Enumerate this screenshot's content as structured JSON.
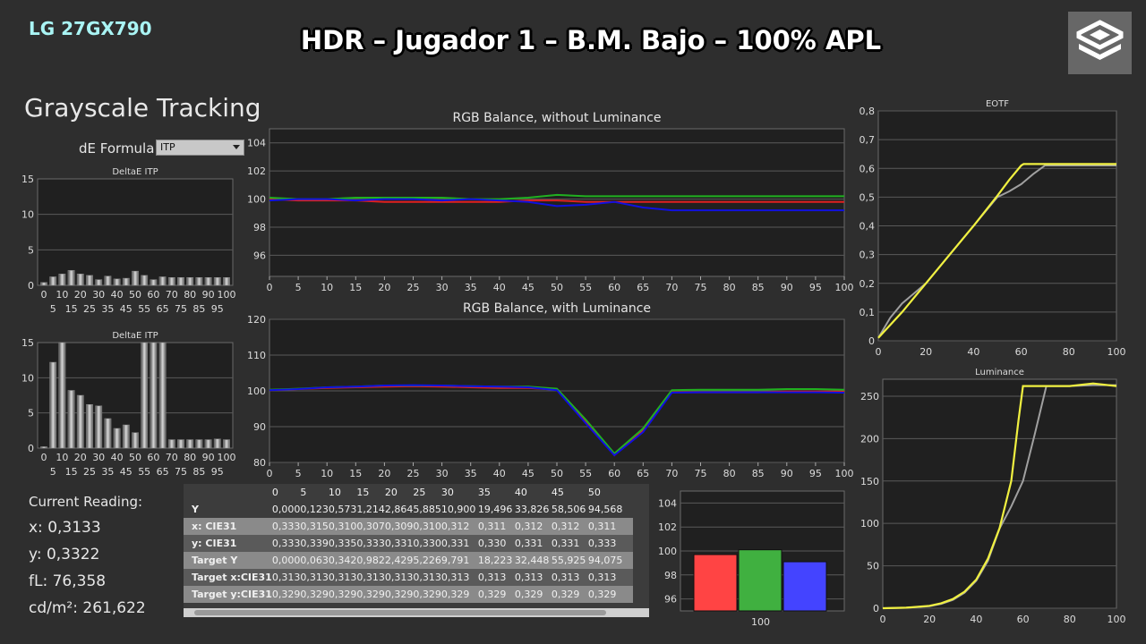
{
  "header": {
    "brand": "LG 27GX790",
    "title": "HDR – Jugador 1 – B.M. Bajo – 100% APL"
  },
  "section_title": "Grayscale Tracking",
  "de_formula": {
    "label": "dE Formula:",
    "value": "ITP"
  },
  "current_reading": {
    "label": "Current Reading:",
    "x": "x: 0,3133",
    "y": "y: 0,3322",
    "fl": "fL: 76,358",
    "cdm2": "cd/m²: 261,622"
  },
  "table": {
    "columns": [
      "0",
      "5",
      "10",
      "15",
      "20",
      "25",
      "30",
      "35",
      "40",
      "45",
      "50"
    ],
    "rows": [
      {
        "label": "Y",
        "values": [
          "0,000",
          "0,123",
          "0,573",
          "1,214",
          "2,864",
          "5,885",
          "10,900",
          "19,496",
          "33,826",
          "58,506",
          "94,568"
        ]
      },
      {
        "label": "x: CIE31",
        "values": [
          "0,333",
          "0,315",
          "0,310",
          "0,307",
          "0,309",
          "0,310",
          "0,312",
          "0,311",
          "0,312",
          "0,312",
          "0,311"
        ]
      },
      {
        "label": "y: CIE31",
        "values": [
          "0,333",
          "0,339",
          "0,335",
          "0,333",
          "0,331",
          "0,330",
          "0,331",
          "0,330",
          "0,331",
          "0,331",
          "0,333"
        ]
      },
      {
        "label": "Target Y",
        "values": [
          "0,000",
          "0,063",
          "0,342",
          "0,982",
          "2,429",
          "5,226",
          "9,791",
          "18,223",
          "32,448",
          "55,925",
          "94,075"
        ]
      },
      {
        "label": "Target x:CIE31",
        "values": [
          "0,313",
          "0,313",
          "0,313",
          "0,313",
          "0,313",
          "0,313",
          "0,313",
          "0,313",
          "0,313",
          "0,313",
          "0,313"
        ]
      },
      {
        "label": "Target y:CIE31",
        "values": [
          "0,329",
          "0,329",
          "0,329",
          "0,329",
          "0,329",
          "0,329",
          "0,329",
          "0,329",
          "0,329",
          "0,329",
          "0,329"
        ]
      }
    ]
  },
  "colors": {
    "red": "#e02020",
    "green": "#20b020",
    "blue": "#1010e0",
    "yellow": "#f0f040",
    "gray": "#a0a0a0",
    "plot_bg": "#202020",
    "grid": "#5a5a5a"
  },
  "chart_data": [
    {
      "id": "deltae_top",
      "type": "bar",
      "title": "DeltaE ITP",
      "ylim": [
        0,
        15
      ],
      "yticks": [
        0,
        5,
        10,
        15
      ],
      "categories": [
        "0",
        "5",
        "10",
        "15",
        "20",
        "25",
        "30",
        "35",
        "40",
        "45",
        "50",
        "55",
        "60",
        "65",
        "70",
        "75",
        "80",
        "85",
        "90",
        "95",
        "100"
      ],
      "xticks_top": [
        "0",
        "10",
        "20",
        "30",
        "40",
        "50",
        "60",
        "70",
        "80",
        "90",
        "100"
      ],
      "xticks_bottom": [
        "5",
        "15",
        "25",
        "35",
        "45",
        "55",
        "65",
        "75",
        "85",
        "95"
      ],
      "values": [
        0.4,
        1.2,
        1.6,
        2.1,
        1.6,
        1.4,
        0.8,
        1.3,
        0.9,
        1.0,
        2.0,
        1.4,
        0.8,
        1.2,
        1.1,
        1.1,
        1.1,
        1.1,
        1.1,
        1.1,
        1.1
      ]
    },
    {
      "id": "deltae_bottom",
      "type": "bar",
      "title": "DeltaE ITP",
      "ylim": [
        0,
        15
      ],
      "yticks": [
        0,
        5,
        10,
        15
      ],
      "categories": [
        "0",
        "5",
        "10",
        "15",
        "20",
        "25",
        "30",
        "35",
        "40",
        "45",
        "50",
        "55",
        "60",
        "65",
        "70",
        "75",
        "80",
        "85",
        "90",
        "95",
        "100"
      ],
      "xticks_top": [
        "0",
        "10",
        "20",
        "30",
        "40",
        "50",
        "60",
        "70",
        "80",
        "90",
        "100"
      ],
      "xticks_bottom": [
        "5",
        "15",
        "25",
        "35",
        "45",
        "55",
        "65",
        "75",
        "85",
        "95"
      ],
      "values": [
        0.2,
        12.2,
        15,
        8.2,
        7.5,
        6.2,
        6.0,
        4.2,
        2.8,
        3.3,
        2.2,
        15,
        15,
        15,
        1.2,
        1.2,
        1.2,
        1.2,
        1.2,
        1.3,
        1.2
      ]
    },
    {
      "id": "rgb_balance_no_lum",
      "type": "line",
      "title": "RGB Balance, without Luminance",
      "ylim": [
        94.5,
        105
      ],
      "yticks": [
        96,
        98,
        100,
        102,
        104
      ],
      "x": [
        0,
        5,
        10,
        15,
        20,
        25,
        30,
        35,
        40,
        45,
        50,
        55,
        60,
        65,
        70,
        75,
        80,
        85,
        90,
        95,
        100
      ],
      "xticks": [
        "0",
        "5",
        "10",
        "15",
        "20",
        "25",
        "30",
        "35",
        "40",
        "45",
        "50",
        "55",
        "60",
        "65",
        "70",
        "75",
        "80",
        "85",
        "90",
        "95",
        "100"
      ],
      "series": [
        {
          "color": "red",
          "values": [
            100.0,
            99.9,
            99.9,
            99.9,
            99.8,
            99.8,
            99.8,
            99.8,
            99.8,
            99.9,
            99.9,
            99.8,
            99.8,
            99.8,
            99.8,
            99.8,
            99.8,
            99.8,
            99.8,
            99.8,
            99.8
          ]
        },
        {
          "color": "green",
          "values": [
            100.1,
            100.0,
            100.0,
            100.1,
            100.1,
            100.1,
            100.1,
            100.0,
            100.0,
            100.1,
            100.3,
            100.2,
            100.2,
            100.2,
            100.2,
            100.2,
            100.2,
            100.2,
            100.2,
            100.2,
            100.2
          ]
        },
        {
          "color": "blue",
          "values": [
            99.9,
            100.0,
            100.0,
            99.9,
            100.0,
            100.0,
            99.9,
            100.0,
            99.9,
            99.8,
            99.5,
            99.6,
            99.8,
            99.4,
            99.2,
            99.2,
            99.2,
            99.2,
            99.2,
            99.2,
            99.2
          ]
        }
      ]
    },
    {
      "id": "rgb_balance_lum",
      "type": "line",
      "title": "RGB Balance, with Luminance",
      "ylim": [
        80,
        120
      ],
      "yticks": [
        80,
        90,
        100,
        110,
        120
      ],
      "x": [
        0,
        5,
        10,
        15,
        20,
        25,
        30,
        35,
        40,
        45,
        50,
        55,
        60,
        65,
        70,
        75,
        80,
        85,
        90,
        95,
        100
      ],
      "xticks": [
        "0",
        "5",
        "10",
        "15",
        "20",
        "25",
        "30",
        "35",
        "40",
        "45",
        "50",
        "55",
        "60",
        "65",
        "70",
        "75",
        "80",
        "85",
        "90",
        "95",
        "100"
      ],
      "series": [
        {
          "color": "red",
          "values": [
            100.2,
            100.5,
            100.8,
            101.0,
            101.2,
            101.3,
            101.2,
            101.0,
            100.8,
            100.8,
            100.3,
            91.5,
            82.0,
            89.0,
            99.6,
            99.6,
            99.6,
            99.6,
            99.8,
            99.8,
            99.8
          ]
        },
        {
          "color": "green",
          "values": [
            100.3,
            100.6,
            101.0,
            101.2,
            101.5,
            101.5,
            101.5,
            101.3,
            101.2,
            101.2,
            100.6,
            92.0,
            82.5,
            89.5,
            100.2,
            100.3,
            100.3,
            100.3,
            100.5,
            100.5,
            100.3
          ]
        },
        {
          "color": "blue",
          "values": [
            100.2,
            100.5,
            101.0,
            101.2,
            101.5,
            101.6,
            101.5,
            101.3,
            101.2,
            101.0,
            100.2,
            91.0,
            82.0,
            88.5,
            99.5,
            99.6,
            99.6,
            99.6,
            99.6,
            99.6,
            99.5
          ]
        }
      ]
    },
    {
      "id": "rgb_current_bar",
      "type": "bar",
      "title": "",
      "ylim": [
        95,
        105
      ],
      "yticks": [
        96,
        98,
        100,
        102,
        104
      ],
      "categories": [
        "100"
      ],
      "series": [
        {
          "color": "red",
          "values": [
            99.7
          ]
        },
        {
          "color": "green",
          "values": [
            100.1
          ]
        },
        {
          "color": "blue",
          "values": [
            99.1
          ]
        }
      ]
    },
    {
      "id": "eotf",
      "type": "line",
      "title": "EOTF",
      "xlim": [
        0,
        100
      ],
      "ylim": [
        0,
        0.8
      ],
      "xticks": [
        0,
        20,
        40,
        60,
        80,
        100
      ],
      "yticks": [
        "0",
        "0,1",
        "0,2",
        "0,3",
        "0,4",
        "0,5",
        "0,6",
        "0,7",
        "0,8"
      ],
      "series": [
        {
          "color": "gray",
          "x": [
            0,
            5,
            10,
            20,
            30,
            40,
            45,
            50,
            55,
            60,
            65,
            70,
            80,
            90,
            100
          ],
          "values": [
            0.01,
            0.08,
            0.13,
            0.2,
            0.3,
            0.4,
            0.45,
            0.5,
            0.52,
            0.545,
            0.58,
            0.61,
            0.61,
            0.61,
            0.61
          ]
        },
        {
          "color": "yellow",
          "x": [
            0,
            10,
            20,
            30,
            40,
            50,
            55,
            60,
            61,
            65,
            70,
            80,
            90,
            100
          ],
          "values": [
            0.01,
            0.1,
            0.2,
            0.3,
            0.4,
            0.505,
            0.56,
            0.61,
            0.615,
            0.615,
            0.615,
            0.615,
            0.615,
            0.615
          ]
        }
      ]
    },
    {
      "id": "luminance",
      "type": "line",
      "title": "Luminance",
      "xlim": [
        0,
        100
      ],
      "ylim": [
        0,
        270
      ],
      "xticks": [
        0,
        20,
        40,
        60,
        80,
        100
      ],
      "yticks": [
        0,
        50,
        100,
        150,
        200,
        250
      ],
      "series": [
        {
          "color": "gray",
          "x": [
            0,
            10,
            20,
            25,
            30,
            35,
            40,
            45,
            50,
            55,
            60,
            65,
            70,
            80,
            90,
            100
          ],
          "values": [
            0,
            0.5,
            2.4,
            5.2,
            9.8,
            18.2,
            32.4,
            55.9,
            94.1,
            120,
            150,
            205,
            262,
            262,
            263,
            263
          ]
        },
        {
          "color": "yellow",
          "x": [
            0,
            10,
            20,
            25,
            30,
            35,
            40,
            45,
            50,
            55,
            58,
            60,
            62,
            65,
            70,
            80,
            90,
            100
          ],
          "values": [
            0,
            0.6,
            2.9,
            5.9,
            10.9,
            19.5,
            33.8,
            58.5,
            94.6,
            150,
            220,
            262,
            262,
            262,
            262,
            262,
            265,
            262
          ]
        }
      ]
    }
  ]
}
